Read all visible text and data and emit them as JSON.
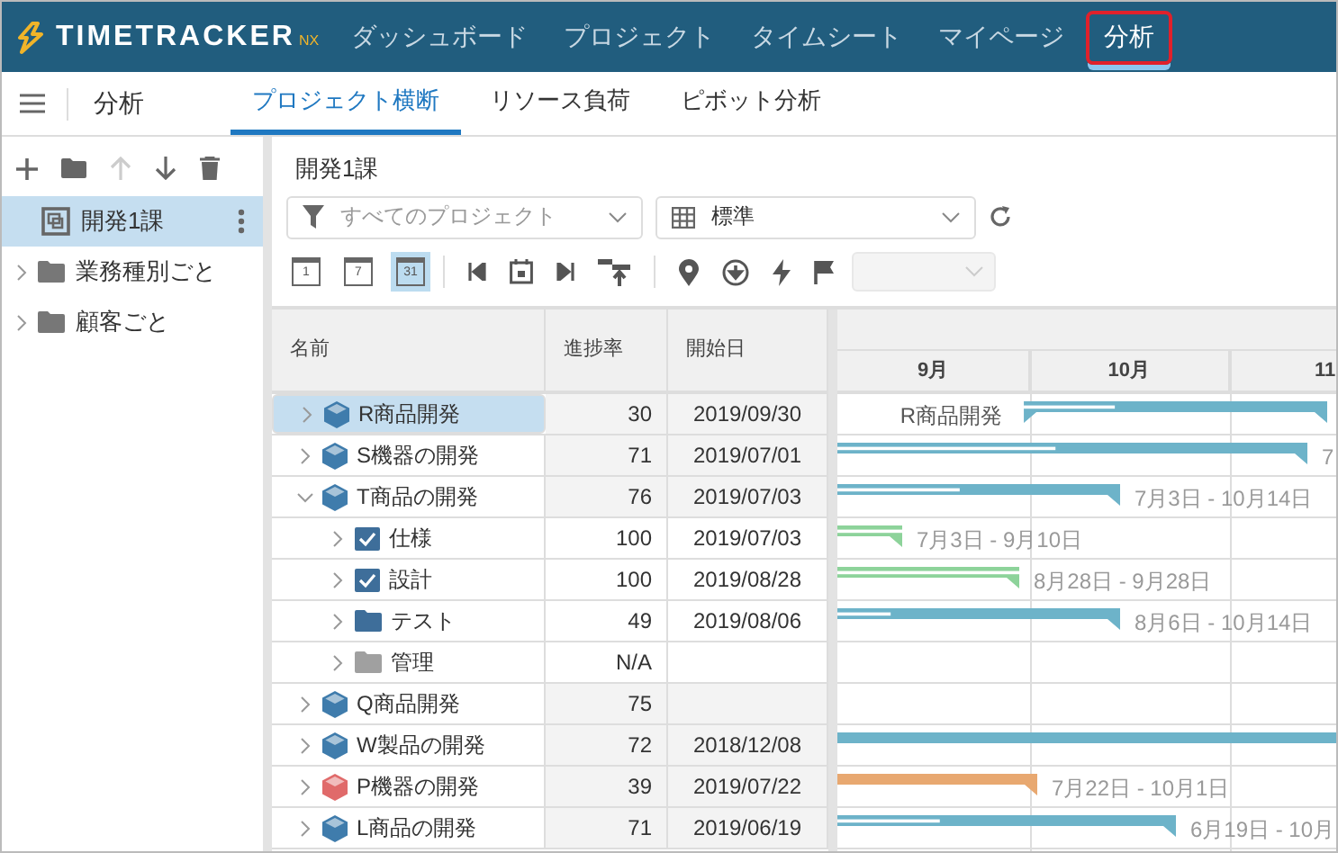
{
  "app": {
    "logo": "TIMETRACKER",
    "logo_suffix": "NX"
  },
  "nav": [
    {
      "label": "ダッシュボード",
      "selected": false
    },
    {
      "label": "プロジェクト",
      "selected": false
    },
    {
      "label": "タイムシート",
      "selected": false
    },
    {
      "label": "マイページ",
      "selected": false
    },
    {
      "label": "分析",
      "selected": true
    }
  ],
  "subnav": {
    "title": "分析",
    "tabs": [
      {
        "label": "プロジェクト横断",
        "selected": true
      },
      {
        "label": "リソース負荷",
        "selected": false
      },
      {
        "label": "ピボット分析",
        "selected": false
      }
    ]
  },
  "sidebar": {
    "tools": [
      {
        "kind": "add",
        "disabled": false
      },
      {
        "kind": "folder",
        "disabled": false
      },
      {
        "kind": "up",
        "disabled": true
      },
      {
        "kind": "down",
        "disabled": false
      },
      {
        "kind": "delete",
        "disabled": false
      }
    ],
    "tree": [
      {
        "label": "開発1課",
        "kind": "org",
        "selected": true
      },
      {
        "label": "業務種別ごと",
        "kind": "folder",
        "selected": false
      },
      {
        "label": "顧客ごと",
        "kind": "folder",
        "selected": false
      }
    ]
  },
  "main": {
    "title": "開発1課",
    "filter": {
      "value": "すべてのプロジェクト"
    },
    "view": {
      "value": "標準"
    },
    "scale_buttons": [
      {
        "label": "1",
        "selected": false
      },
      {
        "label": "7",
        "selected": false
      },
      {
        "label": "31",
        "selected": true
      }
    ],
    "range_select": {
      "disabled": true
    },
    "table": {
      "columns": [
        "名前",
        "進捗率",
        "開始日"
      ],
      "months": [
        "9月",
        "10月",
        "11"
      ],
      "rows": [
        {
          "name": "R商品開発",
          "kind": "project",
          "color": "#3f7cac",
          "expanded": false,
          "selected": true,
          "progress": "30",
          "start": "2019/09/30",
          "bar": {
            "color": "#6db3c9",
            "caption_left": "R商品開発"
          }
        },
        {
          "name": "S機器の開発",
          "kind": "project",
          "color": "#3f7cac",
          "expanded": false,
          "selected": false,
          "progress": "71",
          "start": "2019/07/01",
          "bar": {
            "color": "#6db3c9",
            "label": "7"
          }
        },
        {
          "name": "T商品の開発",
          "kind": "project",
          "color": "#3f7cac",
          "expanded": true,
          "selected": false,
          "progress": "76",
          "start": "2019/07/03",
          "bar": {
            "color": "#6db3c9",
            "label": "7月3日 - 10月14日"
          },
          "children": [
            {
              "name": "仕様",
              "kind": "task",
              "expanded": false,
              "selected": false,
              "progress": "100",
              "start": "2019/07/03",
              "bar": {
                "color": "#8dd39a",
                "label": "7月3日 - 9月10日"
              }
            },
            {
              "name": "設計",
              "kind": "task",
              "expanded": false,
              "selected": false,
              "progress": "100",
              "start": "2019/08/28",
              "bar": {
                "color": "#8dd39a",
                "label": "8月28日 - 9月28日"
              }
            },
            {
              "name": "テスト",
              "kind": "folder",
              "expanded": false,
              "selected": false,
              "progress": "49",
              "start": "2019/08/06",
              "bar": {
                "color": "#6db3c9",
                "label": "8月6日 - 10月14日"
              }
            },
            {
              "name": "管理",
              "kind": "empty-folder",
              "expanded": false,
              "selected": false,
              "progress": "N/A"
            }
          ]
        },
        {
          "name": "Q商品開発",
          "kind": "project",
          "color": "#3f7cac",
          "expanded": false,
          "selected": false,
          "progress": "75"
        },
        {
          "name": "W製品の開発",
          "kind": "project",
          "color": "#3f7cac",
          "expanded": false,
          "selected": false,
          "progress": "72",
          "start": "2018/12/08",
          "bar": {
            "color": "#6db3c9"
          }
        },
        {
          "name": "P機器の開発",
          "kind": "project",
          "color": "#e06a6a",
          "expanded": false,
          "selected": false,
          "progress": "39",
          "start": "2019/07/22",
          "bar": {
            "color": "#e8a870",
            "label": "7月22日 - 10月1日"
          }
        },
        {
          "name": "L商品の開発",
          "kind": "project",
          "color": "#3f7cac",
          "expanded": false,
          "selected": false,
          "progress": "71",
          "start": "2019/06/19",
          "bar": {
            "color": "#6db3c9",
            "label": "6月19日 - 10月"
          }
        }
      ]
    }
  }
}
